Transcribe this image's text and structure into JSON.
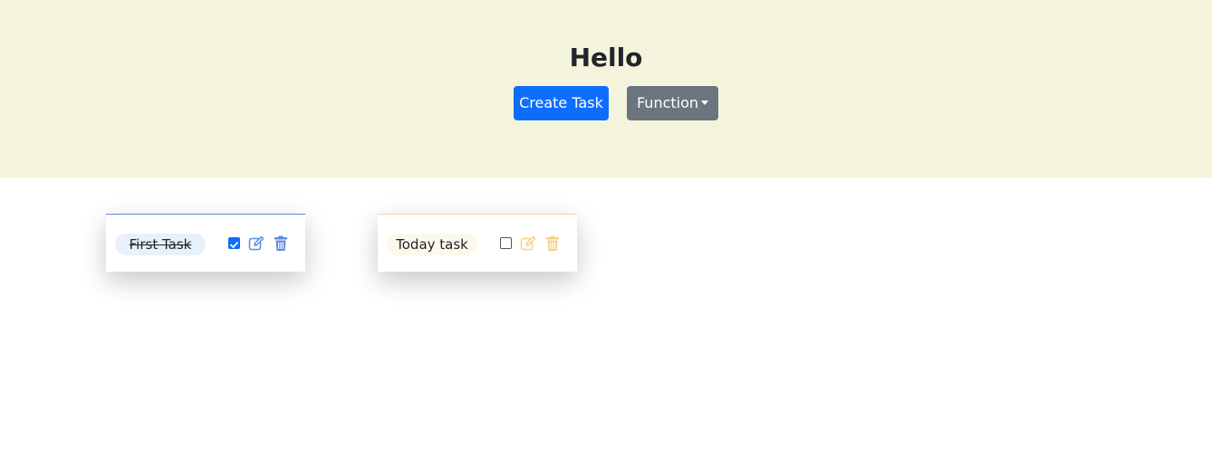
{
  "header": {
    "title": "Hello",
    "create_label": "Create Task",
    "function_label": "Function"
  },
  "tasks": [
    {
      "label": "First Task",
      "done": true,
      "accent": "#5c8de0"
    },
    {
      "label": "Today task",
      "done": false,
      "accent": "#f6d999"
    }
  ],
  "icons": {
    "edit": "edit-icon",
    "delete": "trash-icon",
    "dropdown": "caret-down-icon"
  },
  "colors": {
    "header_bg": "#f4f4dc",
    "primary": "#0d6efd",
    "secondary": "#6c757d"
  }
}
